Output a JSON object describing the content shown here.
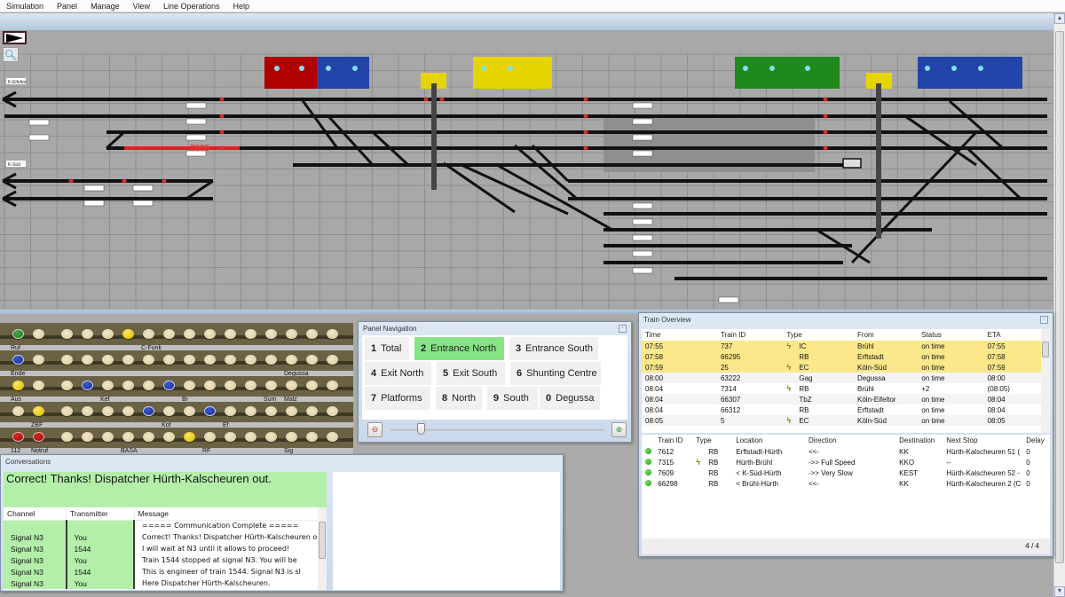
{
  "menu": [
    "Simulation",
    "Panel",
    "Manage",
    "View",
    "Line Operations",
    "Help"
  ],
  "panel": {
    "play_icon": "play-icon",
    "zoom_icon": "magnifier-icon",
    "station_labels": [
      "K-Eifeltor",
      "K-Süd"
    ],
    "train_number_display": "7605"
  },
  "signal_box": {
    "rows": [
      {
        "lamps": [
          "green",
          "off",
          "off",
          "off",
          "off",
          "yellow",
          "off",
          "off",
          "off",
          "off",
          "off",
          "off",
          "off",
          "off",
          "off",
          "off"
        ],
        "labels": [
          {
            "text": "Ruf",
            "pos": 0
          },
          {
            "text": "C-Funk",
            "pos": 6
          }
        ]
      },
      {
        "lamps": [
          "blue",
          "off",
          "off",
          "off",
          "off",
          "off",
          "off",
          "off",
          "off",
          "off",
          "off",
          "off",
          "off",
          "off",
          "off",
          "off"
        ],
        "labels": [
          {
            "text": "Ende",
            "pos": 0
          },
          {
            "text": "Degussa",
            "pos": 13
          }
        ]
      },
      {
        "lamps": [
          "yellow",
          "off",
          "off",
          "blue",
          "off",
          "off",
          "off",
          "blue",
          "off",
          "off",
          "off",
          "off",
          "off",
          "off",
          "off",
          "off"
        ],
        "labels": [
          {
            "text": "Aus",
            "pos": 0
          },
          {
            "text": "Kef",
            "pos": 4
          },
          {
            "text": "Br",
            "pos": 8
          },
          {
            "text": "Sum",
            "pos": 12
          },
          {
            "text": "Malz",
            "pos": 13
          }
        ]
      },
      {
        "lamps": [
          "off",
          "yellow",
          "off",
          "off",
          "off",
          "off",
          "blue",
          "off",
          "off",
          "blue",
          "off",
          "off",
          "off",
          "off",
          "off",
          "off"
        ],
        "labels": [
          {
            "text": "ZBF",
            "pos": 1
          },
          {
            "text": "Kof",
            "pos": 7
          },
          {
            "text": "Ef",
            "pos": 10
          }
        ]
      },
      {
        "lamps": [
          "red",
          "red",
          "off",
          "off",
          "off",
          "off",
          "off",
          "off",
          "yellow",
          "off",
          "off",
          "off",
          "off",
          "off",
          "off",
          "off"
        ],
        "labels": [
          {
            "text": "112",
            "pos": 0
          },
          {
            "text": "Notruf",
            "pos": 1
          },
          {
            "text": "BASA",
            "pos": 5
          },
          {
            "text": "RF",
            "pos": 9
          },
          {
            "text": "Sig",
            "pos": 13
          }
        ]
      }
    ]
  },
  "panel_navigation": {
    "title": "Panel Navigation",
    "buttons": [
      {
        "key": "1",
        "label": "Total",
        "active": false
      },
      {
        "key": "2",
        "label": "Entrance North",
        "active": true
      },
      {
        "key": "3",
        "label": "Entrance South",
        "active": false
      },
      {
        "key": "4",
        "label": "Exit North",
        "active": false
      },
      {
        "key": "5",
        "label": "Exit South",
        "active": false
      },
      {
        "key": "6",
        "label": "Shunting Centre",
        "active": false
      },
      {
        "key": "7",
        "label": "Platforms",
        "active": false
      },
      {
        "key": "8",
        "label": "North",
        "active": false
      },
      {
        "key": "9",
        "label": "South",
        "active": false
      },
      {
        "key": "0",
        "label": "Degussa",
        "active": false
      }
    ],
    "zoom_out_icon": "zoom-out-icon",
    "zoom_in_icon": "zoom-in-icon",
    "zoom_slider_fraction": 0.14
  },
  "train_overview": {
    "title": "Train Overview",
    "schedule_columns": [
      "Time",
      "Train ID",
      "Type",
      "From",
      "Status",
      "ETA"
    ],
    "schedule": [
      {
        "time": "07:55",
        "id": "737",
        "electric": true,
        "type": "IC",
        "from": "Brühl",
        "status": "on time",
        "eta": "07:55",
        "highlight": true
      },
      {
        "time": "07:58",
        "id": "66295",
        "electric": false,
        "type": "RB",
        "from": "Erftstadt",
        "status": "on time",
        "eta": "07:58",
        "highlight": true
      },
      {
        "time": "07:59",
        "id": "25",
        "electric": true,
        "type": "EC",
        "from": "Köln-Süd",
        "status": "on time",
        "eta": "07:59",
        "highlight": true
      },
      {
        "time": "08:00",
        "id": "63222",
        "electric": false,
        "type": "Gag",
        "from": "Degussa",
        "status": "on time",
        "eta": "08:00",
        "highlight": false
      },
      {
        "time": "08:04",
        "id": "7314",
        "electric": true,
        "type": "RB",
        "from": "Brühl",
        "status": "+2",
        "eta": "(08:05)",
        "highlight": false
      },
      {
        "time": "08:04",
        "id": "66307",
        "electric": false,
        "type": "TbZ",
        "from": "Köln-Eifeltor",
        "status": "on time",
        "eta": "08:04",
        "highlight": false
      },
      {
        "time": "08:04",
        "id": "66312",
        "electric": false,
        "type": "RB",
        "from": "Erftstadt",
        "status": "on time",
        "eta": "08:04",
        "highlight": false
      },
      {
        "time": "08:05",
        "id": "5",
        "electric": true,
        "type": "EC",
        "from": "Köln-Süd",
        "status": "on time",
        "eta": "08:05",
        "highlight": false
      }
    ],
    "active_columns": [
      "",
      "Train ID",
      "Type",
      "Location",
      "Direction",
      "Destination",
      "Next Stop",
      "Delay"
    ],
    "active": [
      {
        "id": "7612",
        "electric": false,
        "type": "RB",
        "location": "Erftstadt-Hürth",
        "direction": "<<-",
        "destination": "KK",
        "next_stop": "Hürth-Kalscheuren 51 (",
        "delay": "0"
      },
      {
        "id": "7315",
        "electric": true,
        "type": "RB",
        "location": "Hürth-Brühl",
        "direction": "->> Full Speed",
        "destination": "KKO",
        "next_stop": "--",
        "delay": "0"
      },
      {
        "id": "7609",
        "electric": false,
        "type": "RB",
        "location": "< K-Süd-Hürth",
        "direction": "->> Very Slow",
        "destination": "KEST",
        "next_stop": "Hürth-Kalscheuren 52 -",
        "delay": "0"
      },
      {
        "id": "66298",
        "electric": false,
        "type": "RB",
        "location": "< Brühl-Hürth",
        "direction": "<<-",
        "destination": "KK",
        "next_stop": "Hürth-Kalscheuren 2 (C",
        "delay": "0"
      }
    ],
    "page_indicator": "4 / 4"
  },
  "conversations": {
    "title": "Conversations",
    "current_message": "Correct! Thanks! Dispatcher Hürth-Kalscheuren out.",
    "columns": [
      "Channel",
      "Transmitter",
      "Message"
    ],
    "rows": [
      {
        "channel": "",
        "transmitter": "",
        "message": "===== Communication Complete ====="
      },
      {
        "channel": "Signal N3",
        "transmitter": "You",
        "message": "Correct! Thanks! Dispatcher Hürth-Kalscheuren out."
      },
      {
        "channel": "Signal N3",
        "transmitter": "1544",
        "message": "I will wait at N3 until it allows to proceed!"
      },
      {
        "channel": "Signal N3",
        "transmitter": "You",
        "message": "Train 1544 stopped at signal N3. You will be"
      },
      {
        "channel": "Signal N3",
        "transmitter": "1544",
        "message": "This is engineer of train 1544. Signal N3 is sl"
      },
      {
        "channel": "Signal N3",
        "transmitter": "You",
        "message": "Here Dispatcher Hürth-Kalscheuren."
      }
    ]
  }
}
